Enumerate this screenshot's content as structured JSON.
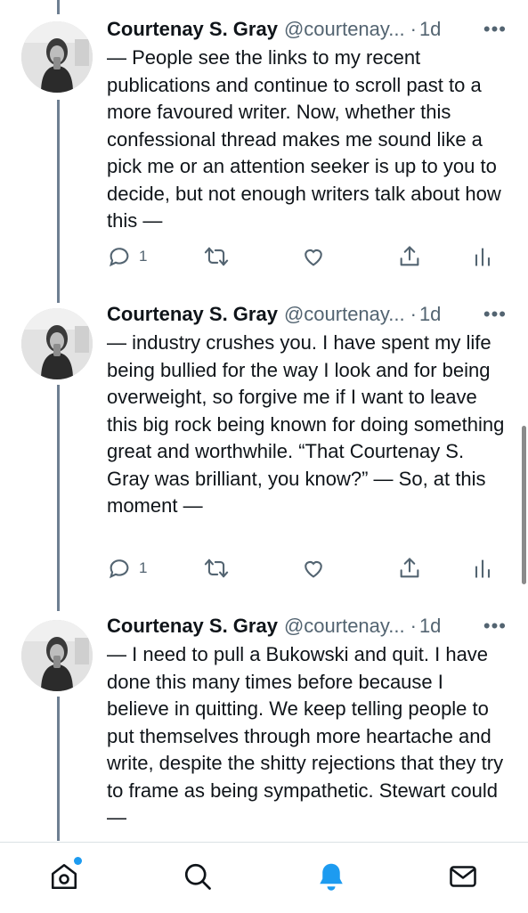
{
  "author": {
    "name": "Courtenay S. Gray",
    "handle": "@courtenay...",
    "separator": "·",
    "timestamp": "1d"
  },
  "tweets": [
    {
      "text": "— People see the links to my recent publications and continue to scroll past to a more favoured writer. Now, whether this confessional thread makes me sound like a pick me or an attention seeker is up to you to decide, but not enough writers talk about how this —",
      "reply_count": "1"
    },
    {
      "text": "— industry crushes you. I have spent my life being bullied for the way I look and for being overweight, so forgive me if I want to leave this big rock being known for doing something great and worthwhile. “That Courtenay S. Gray was brilliant, you know?” — So, at this moment —",
      "reply_count": "1"
    },
    {
      "text": "— I need to pull a Bukowski and quit. I have done this many times before because I believe in quitting. We keep telling people to put themselves through more heartache and write, despite the shitty rejections that they try to frame as being sympathetic. Stewart could —"
    }
  ],
  "icons": {
    "more": "more-icon",
    "reply": "reply-icon",
    "retweet": "retweet-icon",
    "like": "like-icon",
    "share": "share-icon",
    "analytics": "analytics-icon"
  },
  "tabbar": [
    {
      "icon": "home-icon",
      "badge": true
    },
    {
      "icon": "search-icon"
    },
    {
      "icon": "notifications-icon",
      "active": true
    },
    {
      "icon": "messages-icon"
    }
  ],
  "colors": {
    "text": "#0f1419",
    "secondary": "#536471",
    "thread_line": "#6e7f92",
    "accent": "#1d9bf0"
  }
}
